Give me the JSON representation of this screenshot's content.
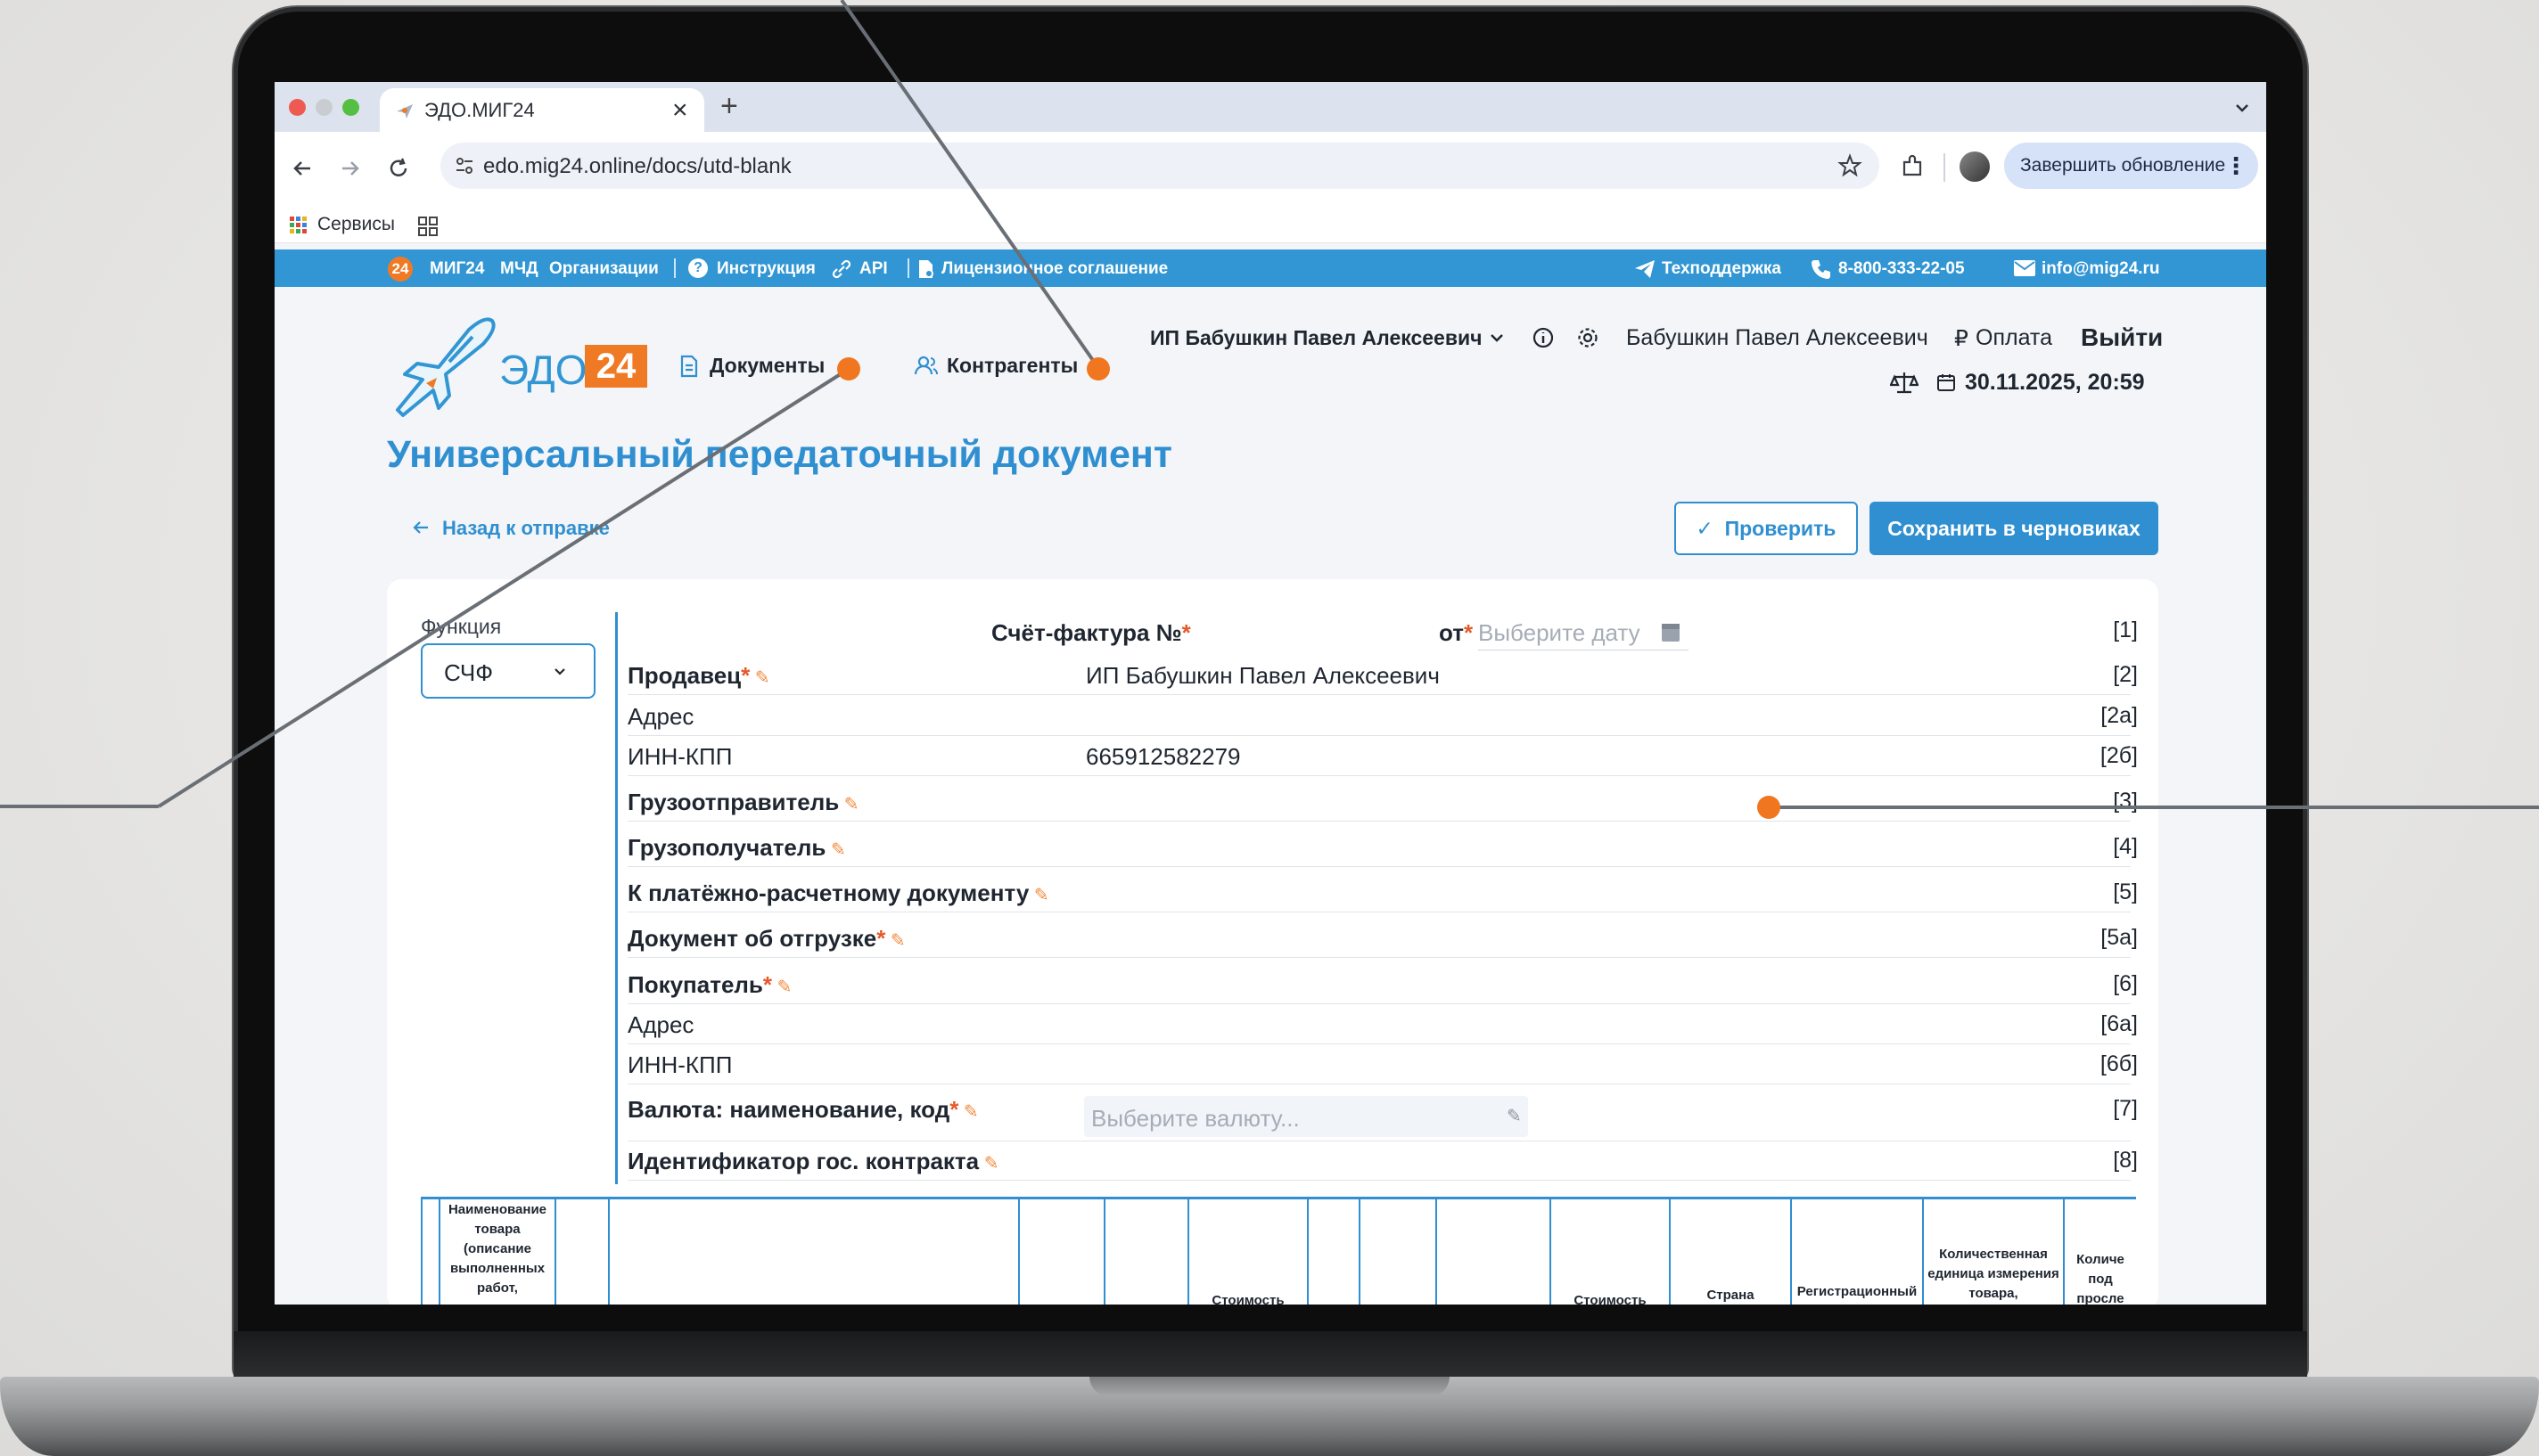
{
  "browser": {
    "tab_title": "ЭДО.МИГ24",
    "tab_close": "×",
    "new_tab": "+",
    "url": "edo.mig24.online/docs/utd-blank",
    "update_button": "Завершить обновление",
    "bookmark_services": "Сервисы"
  },
  "topstrip": {
    "badge": "24",
    "brand": "МИГ24",
    "links": [
      "МЧД",
      "Организации"
    ],
    "instruction": "Инструкция",
    "api": "API",
    "license": "Лицензионное соглашение",
    "support": "Техподдержка",
    "phone": "8-800-333-22-05",
    "email": "info@mig24.ru"
  },
  "header": {
    "logo_text": "ЭДО",
    "logo_badge": "24",
    "nav_documents": "Документы",
    "nav_counterparties": "Контрагенты",
    "org_select": "ИП Бабушкин Павел Алексеевич",
    "user_name": "Бабушкин Павел Алексеевич",
    "payment": "Оплата",
    "currency_symbol": "₽",
    "logout": "Выйти",
    "datetime": "30.11.2025, 20:59"
  },
  "page": {
    "title": "Универсальный передаточный документ",
    "back_link": "Назад к отправке",
    "check_button": "Проверить",
    "save_button": "Сохранить в черновиках"
  },
  "form": {
    "function_label": "Функция",
    "function_value": "СЧФ",
    "invoice_label": "Счёт-фактура №",
    "date_from_label": "от",
    "date_placeholder": "Выберите дату",
    "invoice_num": "[1]",
    "rows": [
      {
        "label": "Продавец",
        "required": "*",
        "value": "ИП Бабушкин Павел Алексеевич",
        "num": "[2]"
      },
      {
        "label": "Адрес",
        "num": "[2а]"
      },
      {
        "label": "ИНН-КПП",
        "value": "665912582279",
        "num": "[2б]"
      },
      {
        "label": "Грузоотправитель",
        "num": "[3]"
      },
      {
        "label": "Грузополучатель",
        "num": "[4]"
      },
      {
        "label": "К платёжно-расчетному документу",
        "num": "[5]"
      },
      {
        "label": "Документ об отгрузке",
        "required": "*",
        "num": "[5а]"
      },
      {
        "label": "Покупатель",
        "required": "*",
        "num": "[6]"
      },
      {
        "label": "Адрес",
        "num": "[6а]"
      },
      {
        "label": "ИНН-КПП",
        "num": "[6б]"
      },
      {
        "label": "Валюта: наименование, код",
        "required": "*",
        "num": "[7]"
      },
      {
        "label": "Идентификатор гос. контракта",
        "num": "[8]"
      }
    ],
    "currency_placeholder": "Выберите валюту..."
  },
  "table": {
    "headers": [
      "Наименование товара (описание выполненных работ,",
      "Стоимость",
      "Стоимость",
      "Страна",
      "Регистрационный",
      "Количественная единица измерения товара,",
      "Количе под просле"
    ]
  },
  "colors": {
    "accent": "#2f8fd0",
    "brand_orange": "#f07a23",
    "strip": "#3196d3",
    "annotation": "#f0761f"
  }
}
